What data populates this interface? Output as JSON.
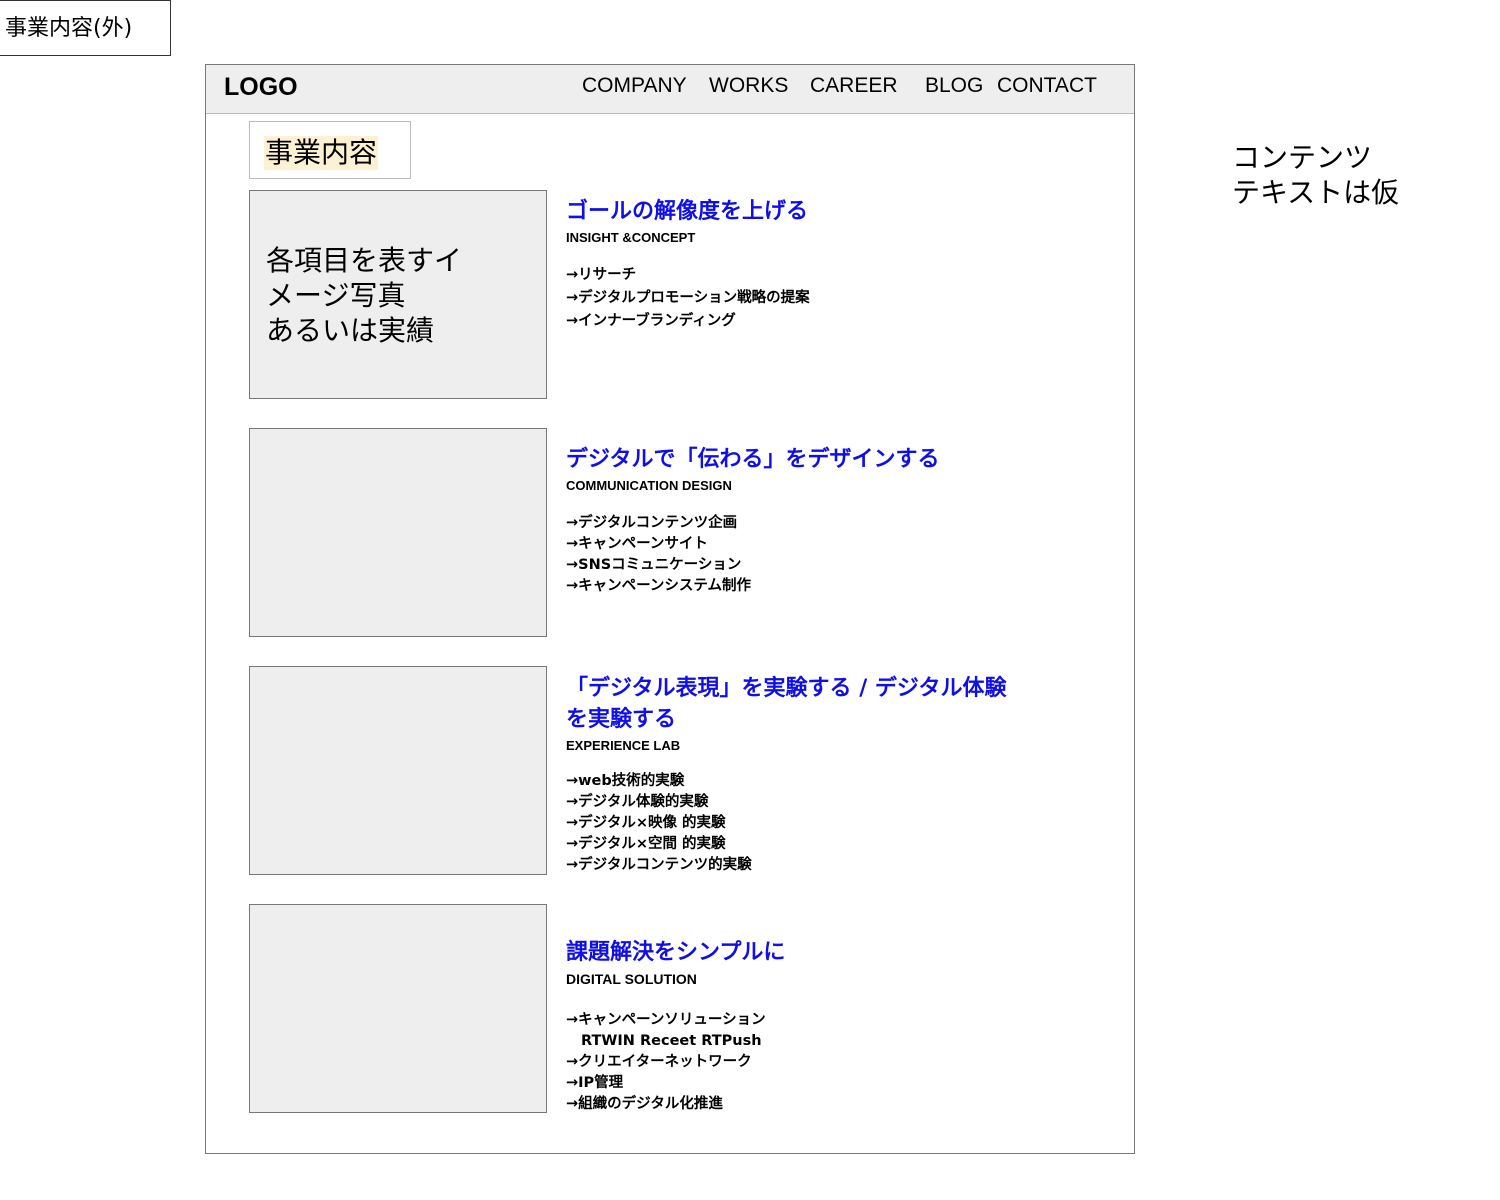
{
  "page_tag": "事業内容(外)",
  "side_note": [
    "コンテンツ",
    "テキストは仮"
  ],
  "header": {
    "logo": "LOGO",
    "nav": [
      "COMPANY",
      "WORKS",
      "CAREER",
      "BLOG",
      "CONTACT"
    ]
  },
  "page_title": "事業内容",
  "image_placeholder_text": [
    "各項目を表すイ",
    "メージ写真",
    "あるいは実績"
  ],
  "sections": [
    {
      "heading": "ゴールの解像度を上げる",
      "subheading": "INSIGHT &CONCEPT",
      "items": [
        "→リサーチ",
        "→デジタルプロモーション戦略の提案",
        "→インナーブランディング"
      ]
    },
    {
      "heading": "デジタルで「伝わる」をデザインする",
      "subheading": "COMMUNICATION DESIGN",
      "items": [
        "→デジタルコンテンツ企画",
        "→キャンペーンサイト",
        "→SNSコミュニケーション",
        "→キャンペーンシステム制作"
      ]
    },
    {
      "heading": "「デジタル表現」を実験する / デジタル体験を実験する",
      "subheading": "EXPERIENCE LAB",
      "items": [
        "→web技術的実験",
        "→デジタル体験的実験",
        "→デジタル×映像 的実験",
        "→デジタル×空間 的実験",
        "→デジタルコンテンツ的実験"
      ]
    },
    {
      "heading": "課題解決をシンプルに",
      "subheading": "DIGITAL SOLUTION",
      "items": [
        "→キャンペーンソリューション",
        "RTWIN Receet RTPush",
        "→クリエイターネットワーク",
        "→IP管理",
        "→組織のデジタル化推進"
      ]
    }
  ],
  "colors": {
    "heading": "#1010e6",
    "header_bg": "#eeeeee",
    "placeholder_bg": "#eeeeee",
    "title_highlight": "#fdf1d3"
  }
}
